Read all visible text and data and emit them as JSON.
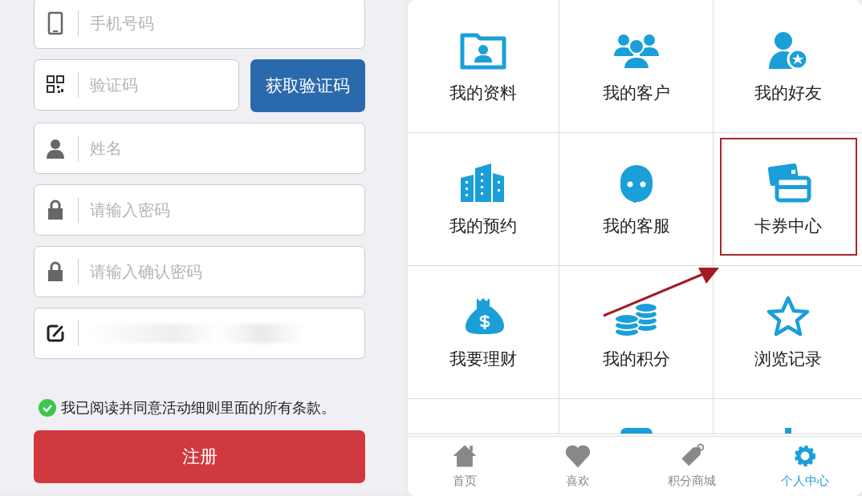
{
  "form": {
    "fields": [
      {
        "kind": "input",
        "placeholder": "手机号码"
      },
      {
        "kind": "code",
        "placeholder": "验证码",
        "button": "获取验证码"
      },
      {
        "kind": "input",
        "placeholder": "姓名"
      },
      {
        "kind": "input",
        "placeholder": "请输入密码"
      },
      {
        "kind": "input",
        "placeholder": "请输入确认密码"
      },
      {
        "kind": "redacted"
      }
    ],
    "agreement": {
      "text": "我已阅读并同意活动细则里面的所有条款。",
      "checked": true
    },
    "submit": "注册"
  },
  "menu": {
    "items": [
      {
        "label": "我的资料",
        "highlighted": false
      },
      {
        "label": "我的客户",
        "highlighted": false
      },
      {
        "label": "我的好友",
        "highlighted": false
      },
      {
        "label": "我的预约",
        "highlighted": false
      },
      {
        "label": "我的客服",
        "highlighted": false
      },
      {
        "label": "卡券中心",
        "highlighted": true
      },
      {
        "label": "我要理财",
        "highlighted": false
      },
      {
        "label": "我的积分",
        "highlighted": false
      },
      {
        "label": "浏览记录",
        "highlighted": false
      }
    ]
  },
  "tab_bar": [
    {
      "label": "首页",
      "selected": false
    },
    {
      "label": "喜欢",
      "selected": false
    },
    {
      "label": "积分商城",
      "selected": false
    },
    {
      "label": "个人中心",
      "selected": true
    }
  ]
}
